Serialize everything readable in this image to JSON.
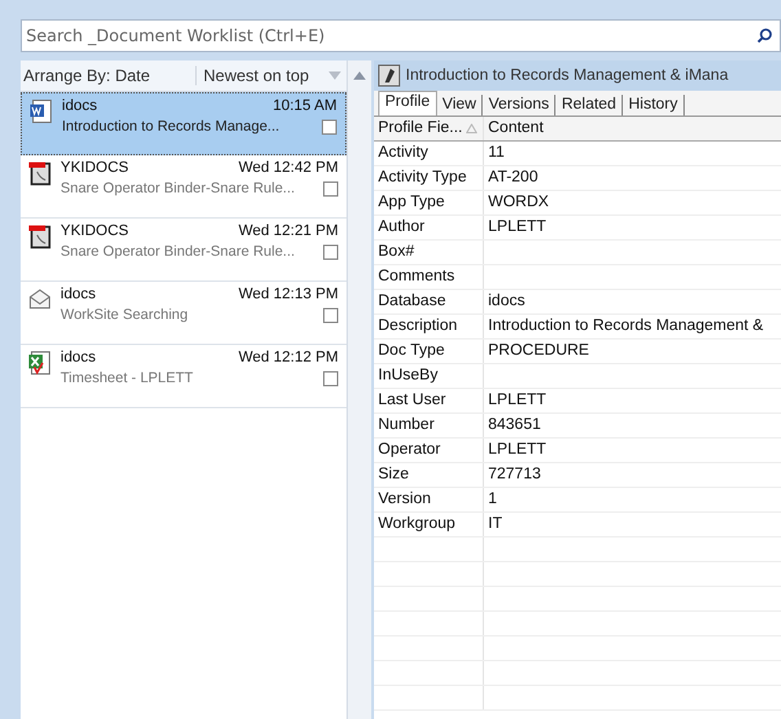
{
  "search": {
    "placeholder": "Search _Document Worklist (Ctrl+E)"
  },
  "list_header": {
    "arrange": "Arrange By: Date",
    "order": "Newest on top"
  },
  "items": [
    {
      "kind": "word",
      "source": "idocs",
      "time": "10:15 AM",
      "title": "Introduction to Records Manage...",
      "selected": true,
      "flagged": false
    },
    {
      "kind": "pdf",
      "source": "YKIDOCS",
      "time": "Wed 12:42 PM",
      "title": "Snare Operator Binder-Snare Rule...",
      "selected": false,
      "flagged": false
    },
    {
      "kind": "pdf",
      "source": "YKIDOCS",
      "time": "Wed 12:21 PM",
      "title": "Snare Operator Binder-Snare Rule...",
      "selected": false,
      "flagged": false
    },
    {
      "kind": "mail",
      "source": "idocs",
      "time": "Wed 12:13 PM",
      "title": "WorkSite Searching",
      "selected": false,
      "flagged": false
    },
    {
      "kind": "excel",
      "source": "idocs",
      "time": "Wed 12:12 PM",
      "title": "Timesheet - LPLETT",
      "selected": false,
      "flagged": false
    }
  ],
  "preview": {
    "title": "Introduction to Records Management & iMana",
    "tabs": [
      {
        "label": "Profile",
        "selected": true
      },
      {
        "label": "View",
        "selected": false
      },
      {
        "label": "Versions",
        "selected": false
      },
      {
        "label": "Related",
        "selected": false
      },
      {
        "label": "History",
        "selected": false
      }
    ],
    "columns": [
      "Profile Fie...",
      "Content"
    ],
    "rows": [
      {
        "field": "Activity",
        "content": "11"
      },
      {
        "field": "Activity Type",
        "content": "AT-200"
      },
      {
        "field": "App Type",
        "content": "WORDX"
      },
      {
        "field": "Author",
        "content": "LPLETT"
      },
      {
        "field": "Box#",
        "content": ""
      },
      {
        "field": "Comments",
        "content": ""
      },
      {
        "field": "Database",
        "content": "idocs"
      },
      {
        "field": "Description",
        "content": "Introduction to Records Management &"
      },
      {
        "field": "Doc Type",
        "content": "PROCEDURE"
      },
      {
        "field": "InUseBy",
        "content": ""
      },
      {
        "field": "Last User",
        "content": "LPLETT"
      },
      {
        "field": "Number",
        "content": "843651"
      },
      {
        "field": "Operator",
        "content": "LPLETT"
      },
      {
        "field": "Size",
        "content": "727713"
      },
      {
        "field": "Version",
        "content": "1"
      },
      {
        "field": "Workgroup",
        "content": "IT"
      }
    ]
  }
}
